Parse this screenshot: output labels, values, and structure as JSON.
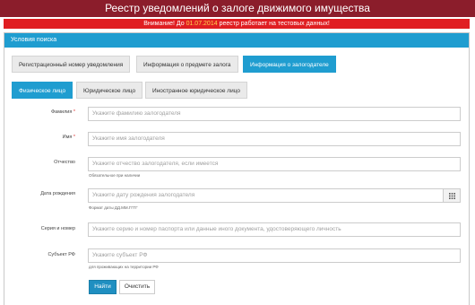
{
  "header": {
    "title": "Реестр уведомлений о залоге движимого имущества"
  },
  "notice": {
    "prefix": "Внимание! До ",
    "date": "01.07.2014",
    "suffix": " реестр работает на тестовых данных!"
  },
  "panel": {
    "title": "Условия поиска"
  },
  "search_tabs": [
    {
      "label": "Регистрационный номер уведомления"
    },
    {
      "label": "Информация о предмете залога"
    },
    {
      "label": "Информация о залогодателе"
    }
  ],
  "person_tabs": [
    {
      "label": "Физическое лицо"
    },
    {
      "label": "Юридическое лицо"
    },
    {
      "label": "Иностранное юридическое лицо"
    }
  ],
  "form": {
    "surname": {
      "label": "Фамилия",
      "required": "*",
      "placeholder": "Укажите фамилию залогодателя"
    },
    "name": {
      "label": "Имя",
      "required": "*",
      "placeholder": "Укажите имя залогодателя"
    },
    "patronymic": {
      "label": "Отчество",
      "placeholder": "Укажите отчество залогодателя, если имеется",
      "hint": "Обязательное при наличии"
    },
    "birthdate": {
      "label": "Дата рождения",
      "placeholder": "Укажите дату рождения залогодателя",
      "hint": "Формат даты ДД.ММ.ГГГГ",
      "icon": "calendar-grid-icon"
    },
    "passport": {
      "label": "Серия и номер",
      "placeholder": "Укажите серию и номер паспорта или данные иного документа, удостоверяющего личность"
    },
    "region": {
      "label": "Субъект РФ",
      "placeholder": "Укажите субъект РФ",
      "hint": "для проживающих на территории РФ"
    }
  },
  "buttons": {
    "find": "Найти",
    "clear": "Очистить"
  },
  "colors": {
    "title_bg": "#8b1d2b",
    "notice_bg": "#e01e22",
    "accent": "#1f9dd0"
  }
}
